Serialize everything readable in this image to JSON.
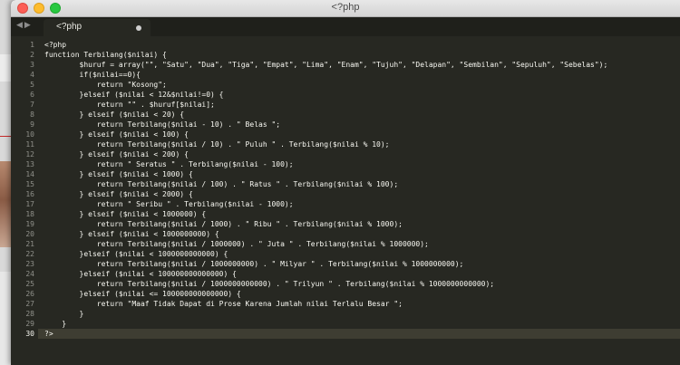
{
  "window": {
    "title": "<?php"
  },
  "tab": {
    "label": "<?php"
  },
  "editor": {
    "active_line": 30,
    "lines": [
      "<?php",
      "function Terbilang($nilai) {",
      "        $huruf = array(\"\", \"Satu\", \"Dua\", \"Tiga\", \"Empat\", \"Lima\", \"Enam\", \"Tujuh\", \"Delapan\", \"Sembilan\", \"Sepuluh\", \"Sebelas\");",
      "        if($nilai==0){",
      "            return \"Kosong\";",
      "        }elseif ($nilai < 12&$nilai!=0) {",
      "            return \"\" . $huruf[$nilai];",
      "        } elseif ($nilai < 20) {",
      "            return Terbilang($nilai - 10) . \" Belas \";",
      "        } elseif ($nilai < 100) {",
      "            return Terbilang($nilai / 10) . \" Puluh \" . Terbilang($nilai % 10);",
      "        } elseif ($nilai < 200) {",
      "            return \" Seratus \" . Terbilang($nilai - 100);",
      "        } elseif ($nilai < 1000) {",
      "            return Terbilang($nilai / 100) . \" Ratus \" . Terbilang($nilai % 100);",
      "        } elseif ($nilai < 2000) {",
      "            return \" Seribu \" . Terbilang($nilai - 1000);",
      "        } elseif ($nilai < 1000000) {",
      "            return Terbilang($nilai / 1000) . \" Ribu \" . Terbilang($nilai % 1000);",
      "        } elseif ($nilai < 1000000000) {",
      "            return Terbilang($nilai / 1000000) . \" Juta \" . Terbilang($nilai % 1000000);",
      "        }elseif ($nilai < 1000000000000) {",
      "            return Terbilang($nilai / 1000000000) . \" Milyar \" . Terbilang($nilai % 1000000000);",
      "        }elseif ($nilai < 100000000000000) {",
      "            return Terbilang($nilai / 1000000000000) . \" Trilyun \" . Terbilang($nilai % 1000000000000);",
      "        }elseif ($nilai <= 100000000000000) {",
      "            return \"Maaf Tidak Dapat di Prose Karena Jumlah nilai Terlalu Besar \";",
      "        }",
      "    }",
      "?>"
    ]
  }
}
